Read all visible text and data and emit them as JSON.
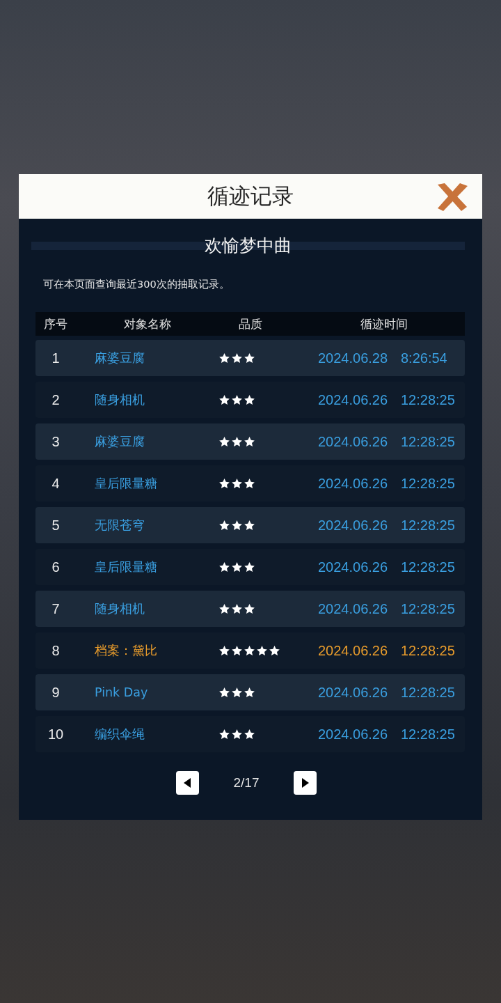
{
  "dialog": {
    "title": "循迹记录",
    "subtitle": "欢愉梦中曲",
    "description": "可在本页面查询最近300次的抽取记录。"
  },
  "table": {
    "columns": [
      "序号",
      "对象名称",
      "品质",
      "循迹时间"
    ],
    "rows": [
      {
        "index": "1",
        "name": "麻婆豆腐",
        "stars": 3,
        "date": "2024.06.28",
        "time": "8:26:54",
        "color": "#3a9fe0"
      },
      {
        "index": "2",
        "name": "随身相机",
        "stars": 3,
        "date": "2024.06.26",
        "time": "12:28:25",
        "color": "#3a9fe0"
      },
      {
        "index": "3",
        "name": "麻婆豆腐",
        "stars": 3,
        "date": "2024.06.26",
        "time": "12:28:25",
        "color": "#3a9fe0"
      },
      {
        "index": "4",
        "name": "皇后限量糖",
        "stars": 3,
        "date": "2024.06.26",
        "time": "12:28:25",
        "color": "#3a9fe0"
      },
      {
        "index": "5",
        "name": "无限苍穹",
        "stars": 3,
        "date": "2024.06.26",
        "time": "12:28:25",
        "color": "#3a9fe0"
      },
      {
        "index": "6",
        "name": "皇后限量糖",
        "stars": 3,
        "date": "2024.06.26",
        "time": "12:28:25",
        "color": "#3a9fe0"
      },
      {
        "index": "7",
        "name": "随身相机",
        "stars": 3,
        "date": "2024.06.26",
        "time": "12:28:25",
        "color": "#3a9fe0"
      },
      {
        "index": "8",
        "name": "档案：黛比",
        "stars": 5,
        "date": "2024.06.26",
        "time": "12:28:25",
        "color": "#e89c2c"
      },
      {
        "index": "9",
        "name": "Pink Day",
        "stars": 3,
        "date": "2024.06.26",
        "time": "12:28:25",
        "color": "#3a9fe0"
      },
      {
        "index": "10",
        "name": "编织伞绳",
        "stars": 3,
        "date": "2024.06.26",
        "time": "12:28:25",
        "color": "#3a9fe0"
      }
    ]
  },
  "pagination": {
    "page": "2/17"
  }
}
